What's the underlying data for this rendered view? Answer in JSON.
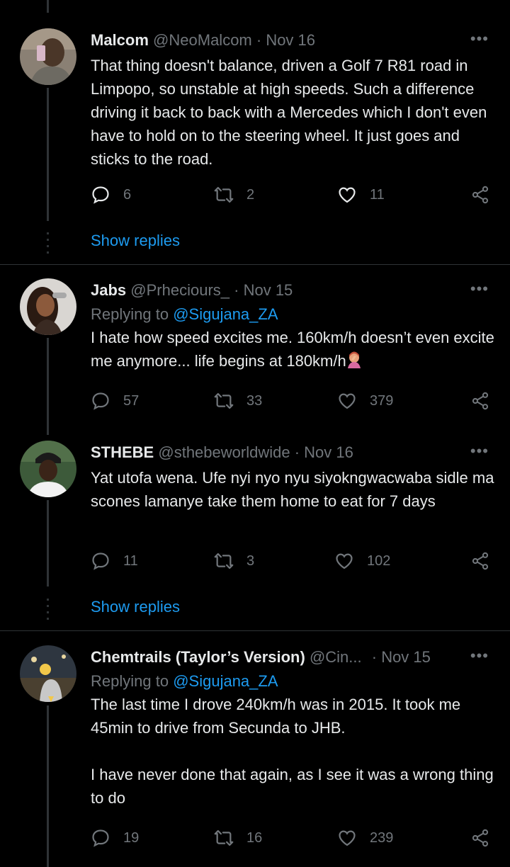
{
  "tweets": [
    {
      "name": "Malcom",
      "handle": "@NeoMalcom",
      "date": "· Nov 16",
      "body": "That thing doesn't balance, driven a Golf 7 R81 road in Limpopo, so unstable at high speeds. Such a difference driving it back to back with a Mercedes which I don't even have to hold on to the steering wheel. It just goes and sticks to the road.",
      "replies": "6",
      "retweets": "2",
      "likes": "11",
      "show_replies": "Show replies"
    },
    {
      "name": "Jabs",
      "handle": "@Prheciours_",
      "date": "· Nov 15",
      "replying_prefix": "Replying to",
      "replying_to": "@Sigujana_ZA",
      "body": "I hate how speed excites me. 160km/h doesn’t even excite me anymore... life begins at 180km/h",
      "replies": "57",
      "retweets": "33",
      "likes": "379"
    },
    {
      "name": "STHEBE",
      "handle": "@sthebeworldwide",
      "date": "· Nov 16",
      "body": "Yat utofa wena. Ufe nyi nyo nyu siyokngwacwaba sidle ma scones lamanye take them home to eat for 7 days",
      "replies": "11",
      "retweets": "3",
      "likes": "102",
      "show_replies": "Show replies"
    },
    {
      "name": "Chemtrails (Taylor’s Version)",
      "handle": "@Cin...",
      "date": "· Nov 15",
      "replying_prefix": "Replying to",
      "replying_to": "@Sigujana_ZA",
      "body": "The last time I drove 240km/h was in 2015. It took me 45min to drive from Secunda to JHB.\n\nI have never done that again, as I see it was a wrong thing to do",
      "replies": "19",
      "retweets": "16",
      "likes": "239"
    }
  ],
  "more_label": "•••",
  "icons": {
    "reply": "reply-icon",
    "retweet": "retweet-icon",
    "like": "heart-icon",
    "share": "share-icon"
  },
  "colors": {
    "background": "#000000",
    "text": "#e7e9ea",
    "muted": "#71767b",
    "link": "#1d9bf0",
    "divider": "#2f3336"
  }
}
